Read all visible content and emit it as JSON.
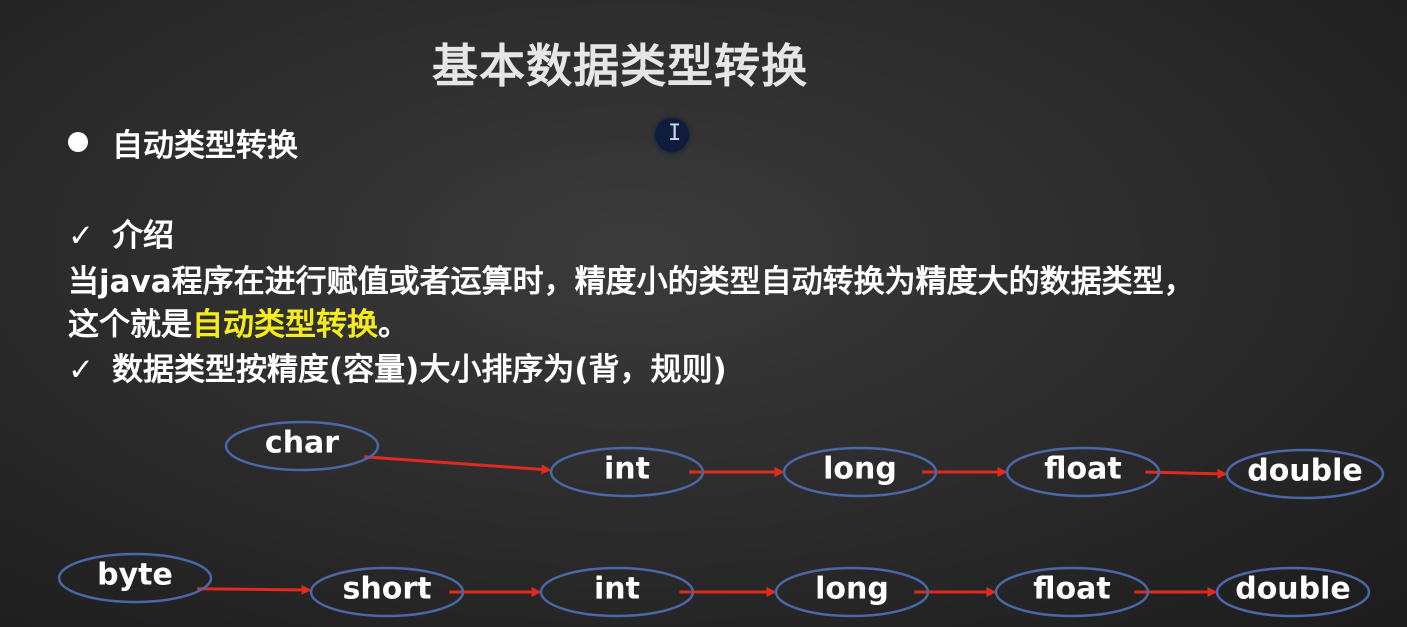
{
  "title": "基本数据类型转换",
  "bullet_heading": "自动类型转换",
  "intro_heading": "介绍",
  "intro_line1": "当java程序在进行赋值或者运算时，精度小的类型自动转换为精度大的数据类型，",
  "intro_line2_prefix": "这个就是",
  "intro_line2_highlight": "自动类型转换",
  "intro_line2_suffix": "。",
  "order_heading": "数据类型按精度(容量)大小排序为(背，规则)",
  "check_symbol": "✓",
  "cursor_glyph": "I",
  "colors": {
    "highlight": "#f5ec1d",
    "arrow": "#e02a1e",
    "ellipse": "#4a67a8"
  },
  "chain1": {
    "nodes": [
      {
        "id": "char",
        "label": "char"
      },
      {
        "id": "int",
        "label": "int"
      },
      {
        "id": "long",
        "label": "long"
      },
      {
        "id": "float",
        "label": "float"
      },
      {
        "id": "double",
        "label": "double"
      }
    ],
    "edges": [
      [
        "char",
        "int"
      ],
      [
        "int",
        "long"
      ],
      [
        "long",
        "float"
      ],
      [
        "float",
        "double"
      ]
    ]
  },
  "chain2": {
    "nodes": [
      {
        "id": "byte",
        "label": "byte"
      },
      {
        "id": "short",
        "label": "short"
      },
      {
        "id": "int",
        "label": "int"
      },
      {
        "id": "long",
        "label": "long"
      },
      {
        "id": "float",
        "label": "float"
      },
      {
        "id": "double",
        "label": "double"
      }
    ],
    "edges": [
      [
        "byte",
        "short"
      ],
      [
        "short",
        "int"
      ],
      [
        "int",
        "long"
      ],
      [
        "long",
        "float"
      ],
      [
        "float",
        "double"
      ]
    ]
  }
}
